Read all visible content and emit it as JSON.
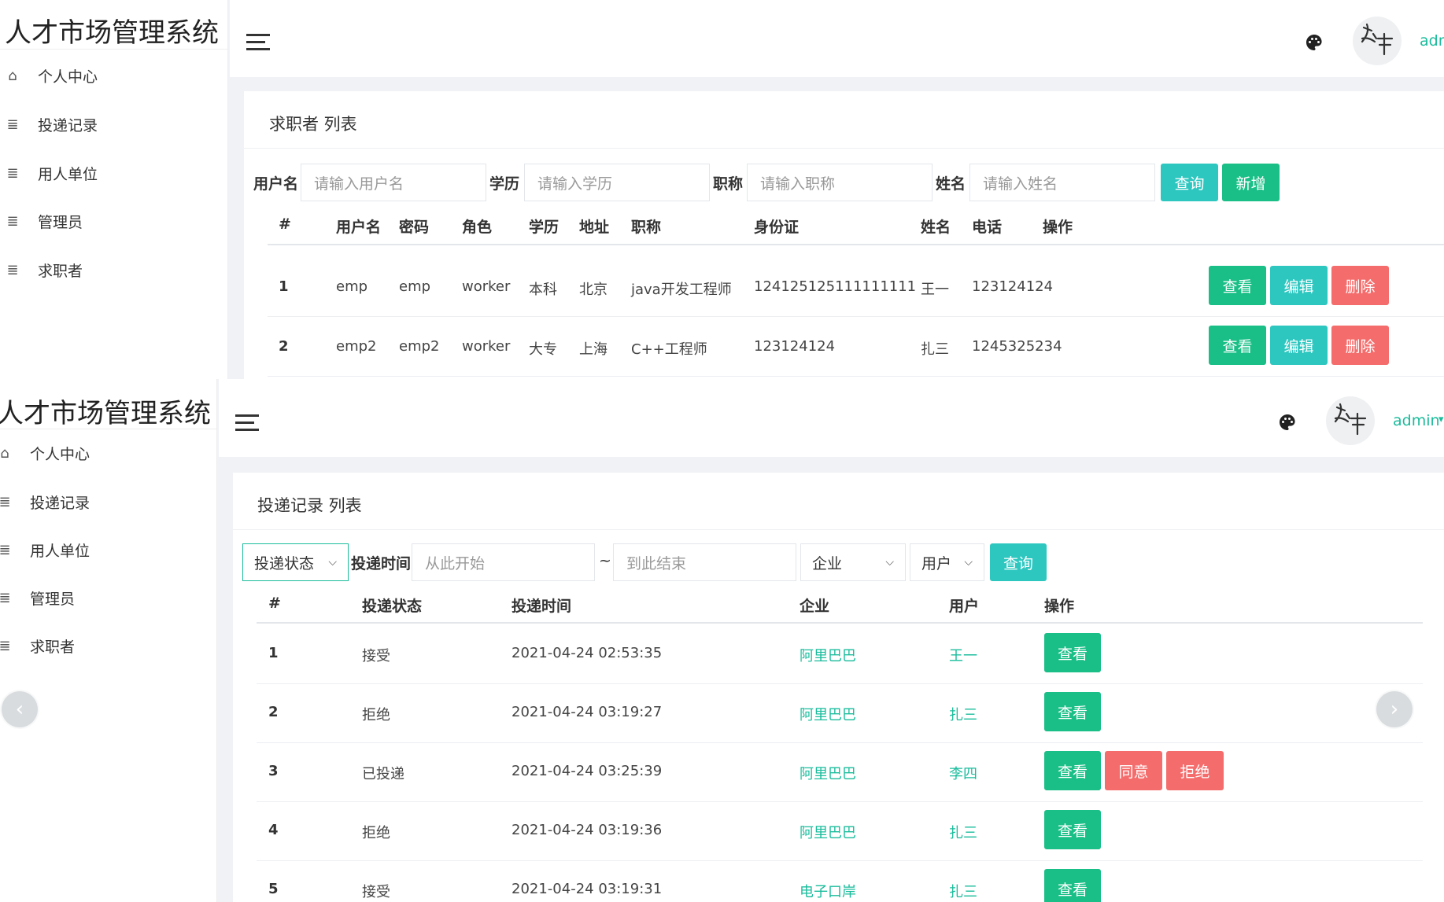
{
  "colors": {
    "accent": "#1abc9c",
    "teal_button": "#2ec7c0",
    "green_button": "#19bf86",
    "red_button": "#f56c6c"
  },
  "top_view": {
    "brand": "人才市场管理系统",
    "menu": [
      {
        "label": "个人中心",
        "icon": "home-icon"
      },
      {
        "label": "投递记录",
        "icon": "list-icon"
      },
      {
        "label": "用人单位",
        "icon": "list-icon"
      },
      {
        "label": "管理员",
        "icon": "list-icon"
      },
      {
        "label": "求职者",
        "icon": "list-icon"
      }
    ],
    "user": "adm",
    "card_title": "求职者 列表",
    "filters": [
      {
        "label": "用户名",
        "placeholder": "请输入用户名"
      },
      {
        "label": "学历",
        "placeholder": "请输入学历"
      },
      {
        "label": "职称",
        "placeholder": "请输入职称"
      },
      {
        "label": "姓名",
        "placeholder": "请输入姓名"
      }
    ],
    "query_label": "查询",
    "add_label": "新增",
    "columns": [
      "#",
      "用户名",
      "密码",
      "角色",
      "学历",
      "地址",
      "职称",
      "身份证",
      "姓名",
      "电话",
      "操作"
    ],
    "rows": [
      [
        "1",
        "emp",
        "emp",
        "worker",
        "本科",
        "北京",
        "java开发工程师",
        "124125125111111111",
        "王一",
        "123124124"
      ],
      [
        "2",
        "emp2",
        "emp2",
        "worker",
        "大专",
        "上海",
        "C++工程师",
        "123124124",
        "扎三",
        "1245325234"
      ]
    ],
    "actions": {
      "view": "查看",
      "edit": "编辑",
      "delete": "删除"
    }
  },
  "bottom_view": {
    "brand": "人才市场管理系统",
    "menu": [
      {
        "label": "个人中心",
        "icon": "home-icon"
      },
      {
        "label": "投递记录",
        "icon": "list-icon"
      },
      {
        "label": "用人单位",
        "icon": "list-icon"
      },
      {
        "label": "管理员",
        "icon": "list-icon"
      },
      {
        "label": "求职者",
        "icon": "list-icon"
      }
    ],
    "user": "admin",
    "card_title": "投递记录 列表",
    "status_select": "投递状态",
    "time_label": "投递时间",
    "start_placeholder": "从此开始",
    "range_sep": "~",
    "end_placeholder": "到此结束",
    "company_select": "企业",
    "user_select": "用户",
    "query_label": "查询",
    "columns": [
      "#",
      "投递状态",
      "投递时间",
      "企业",
      "用户",
      "操作"
    ],
    "rows": [
      {
        "idx": "1",
        "status": "接受",
        "time": "2021-04-24 02:53:35",
        "company": "阿里巴巴",
        "user": "王一",
        "extra": false
      },
      {
        "idx": "2",
        "status": "拒绝",
        "time": "2021-04-24 03:19:27",
        "company": "阿里巴巴",
        "user": "扎三",
        "extra": false
      },
      {
        "idx": "3",
        "status": "已投递",
        "time": "2021-04-24 03:25:39",
        "company": "阿里巴巴",
        "user": "李四",
        "extra": true
      },
      {
        "idx": "4",
        "status": "拒绝",
        "time": "2021-04-24 03:19:36",
        "company": "阿里巴巴",
        "user": "扎三",
        "extra": false
      },
      {
        "idx": "5",
        "status": "接受",
        "time": "2021-04-24 03:19:31",
        "company": "电子口岸",
        "user": "扎三",
        "extra": false
      }
    ],
    "actions": {
      "view": "查看",
      "agree": "同意",
      "reject": "拒绝"
    }
  }
}
